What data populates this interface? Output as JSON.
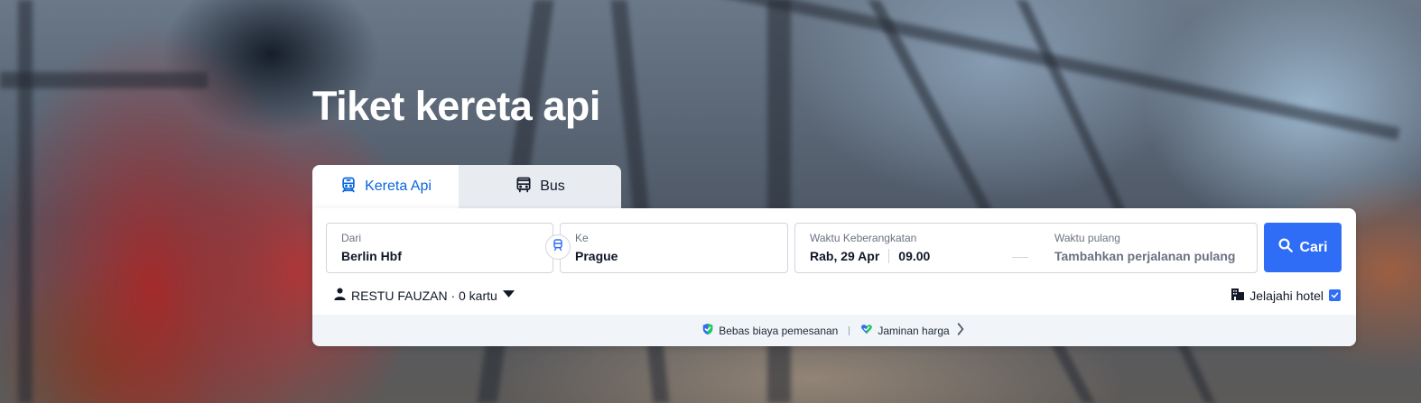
{
  "hero": {
    "title": "Tiket kereta api"
  },
  "tabs": [
    {
      "label": "Kereta Api",
      "icon": "train-icon",
      "active": true
    },
    {
      "label": "Bus",
      "icon": "bus-icon",
      "active": false
    }
  ],
  "search": {
    "from": {
      "label": "Dari",
      "value": "Berlin Hbf"
    },
    "to": {
      "label": "Ke",
      "value": "Prague"
    },
    "swap_icon": "train-swap-icon",
    "departure": {
      "label": "Waktu Keberangkatan",
      "date": "Rab, 29 Apr",
      "time": "09.00"
    },
    "return": {
      "label": "Waktu pulang",
      "placeholder": "Tambahkan perjalanan pulang"
    },
    "button_label": "Cari"
  },
  "passenger": {
    "label": "RESTU FAUZAN · 0 kartu"
  },
  "hotel": {
    "label": "Jelajahi hotel",
    "checked": true
  },
  "benefits": {
    "items": [
      {
        "label": "Bebas biaya pemesanan",
        "icon": "shield-check-icon"
      },
      {
        "label": "Jaminan harga",
        "icon": "heart-check-icon"
      }
    ]
  },
  "colors": {
    "accent": "#2f6df6",
    "tab_active_text": "#0a66e0",
    "benefit_bar": "#f1f4f8"
  }
}
